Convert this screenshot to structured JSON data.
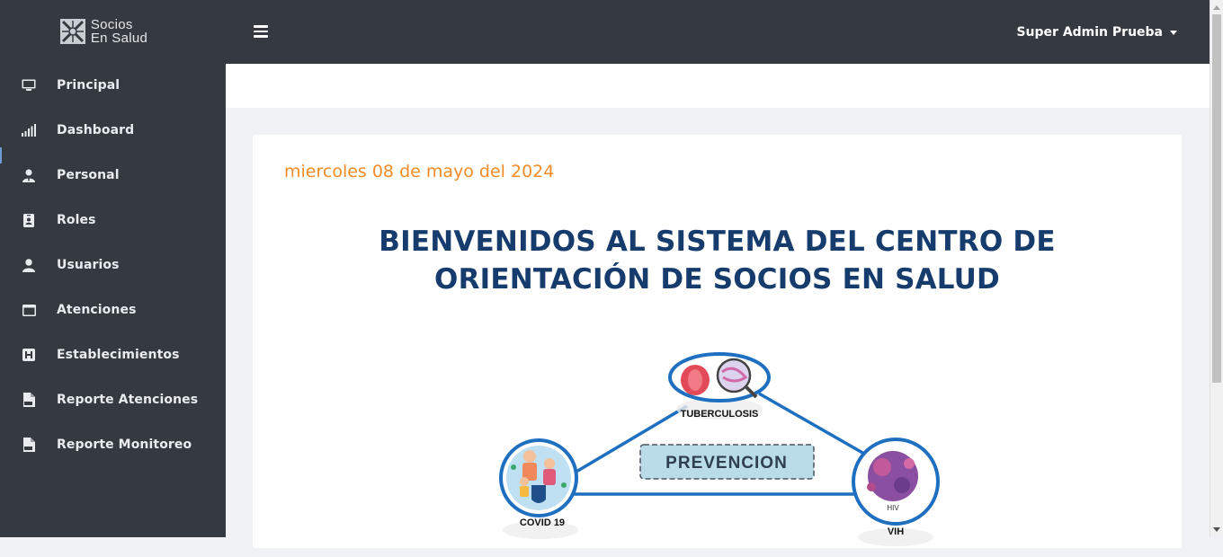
{
  "brand": {
    "line1": "Socios",
    "line2": "En Salud"
  },
  "sidebar": {
    "items": [
      {
        "label": "Principal",
        "icon": "monitor-icon"
      },
      {
        "label": "Dashboard",
        "icon": "signal-bars-icon"
      },
      {
        "label": "Personal",
        "icon": "user-tie-icon"
      },
      {
        "label": "Roles",
        "icon": "id-badge-icon"
      },
      {
        "label": "Usuarios",
        "icon": "user-icon"
      },
      {
        "label": "Atenciones",
        "icon": "window-icon"
      },
      {
        "label": "Establecimientos",
        "icon": "hospital-icon"
      },
      {
        "label": "Reporte Atenciones",
        "icon": "pdf-file-icon"
      },
      {
        "label": "Reporte Monitoreo",
        "icon": "pdf-file-icon"
      }
    ]
  },
  "header": {
    "user_name": "Super Admin Prueba"
  },
  "main": {
    "date": "miercoles 08 de mayo del 2024",
    "welcome_line1": "BIENVENIDOS AL SISTEMA DEL CENTRO DE",
    "welcome_line2": "ORIENTACIÓN DE SOCIOS EN SALUD",
    "diagram": {
      "center": "PREVENCION",
      "nodes": {
        "top": "TUBERCULOSIS",
        "left": "COVID 19",
        "right": "VIH",
        "right_inner": "HIV"
      }
    }
  },
  "colors": {
    "sidebar_bg": "#343a40",
    "date": "#f28c28",
    "title": "#163c6e",
    "diagram_line": "#1e6fc0",
    "center_box": "#b9dce8"
  }
}
